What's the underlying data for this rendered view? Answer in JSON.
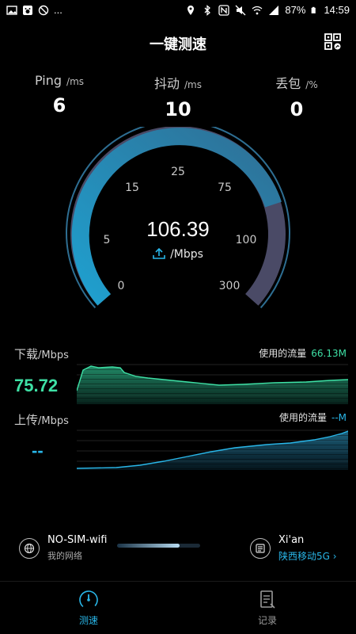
{
  "status_bar": {
    "dots": "...",
    "battery": "87%",
    "time": "14:59"
  },
  "header": {
    "title": "一键测速"
  },
  "metrics": [
    {
      "label": "Ping",
      "unit": "/ms",
      "value": "6"
    },
    {
      "label": "抖动",
      "unit": "/ms",
      "value": "10"
    },
    {
      "label": "丢包",
      "unit": "/%",
      "value": "0"
    }
  ],
  "gauge": {
    "ticks": [
      "0",
      "5",
      "15",
      "25",
      "75",
      "100",
      "300"
    ],
    "speed": "106.39",
    "unit": "/Mbps",
    "mode_icon": "upload-icon",
    "colors": {
      "active": "#29a9d6",
      "inactive": "#4a4a66"
    }
  },
  "download": {
    "label": "下载",
    "unit": "/Mbps",
    "value": "75.72",
    "usage_label": "使用的流量",
    "usage_value": "66.13M",
    "color": "#3ee0a5"
  },
  "upload": {
    "label": "上传",
    "unit": "/Mbps",
    "value": "--",
    "usage_label": "使用的流量",
    "usage_value": "--M",
    "color": "#29b6e8"
  },
  "network": {
    "name": "NO-SIM-wifi",
    "sub": "我的网络",
    "location": "Xi'an",
    "carrier": "陕西移动5G",
    "progress": 0.75
  },
  "nav": [
    {
      "label": "测速",
      "icon": "speedometer-icon",
      "active": true
    },
    {
      "label": "记录",
      "icon": "record-icon",
      "active": false
    }
  ]
}
